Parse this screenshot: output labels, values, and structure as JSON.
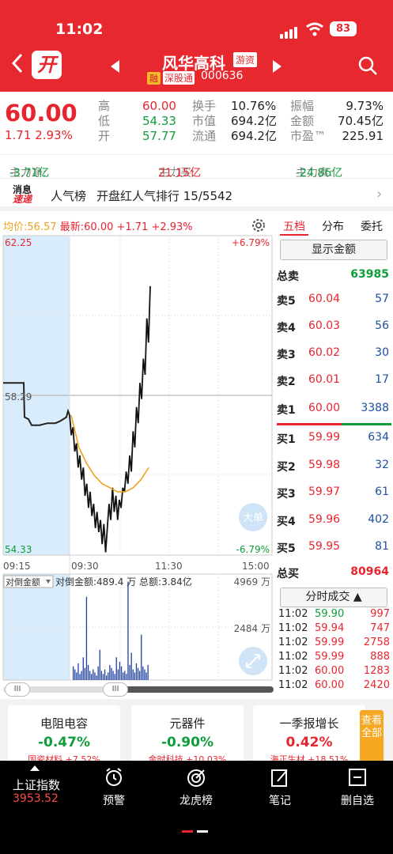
{
  "status": {
    "time": "11:02",
    "battery": "83"
  },
  "header": {
    "logo": "开",
    "stock_name": "风华高科",
    "badge_tag": "游资",
    "badge_rong": "融",
    "badge_connect": "深股通",
    "stock_code": "000636"
  },
  "quote": {
    "price": "60.00",
    "change": "1.71",
    "change_pct": "2.93%",
    "high_label": "高",
    "high": "60.00",
    "low_label": "低",
    "low": "54.33",
    "open_label": "开",
    "open": "57.77",
    "turnover_label": "换手",
    "turnover": "10.76%",
    "mktcap_label": "市值",
    "mktcap": "694.2亿",
    "float_label": "流通",
    "float": "694.2亿",
    "amplitude_label": "振幅",
    "amplitude": "9.73%",
    "amount_label": "金额",
    "amount": "70.45亿",
    "pe_label": "市盈™",
    "pe": "225.91"
  },
  "main_flow": {
    "net_label": "主力净:",
    "net": "-3.71亿",
    "buy_label": "主力买:",
    "buy": "21.15亿",
    "sell_label": "主力卖:",
    "sell": "-24.86亿"
  },
  "news": {
    "logo_top": "消息",
    "logo_bottom": "速递",
    "title": "人气榜",
    "text": "开盘红人气排行 15/5542"
  },
  "chart_info": {
    "avg_label": "均价:",
    "avg": "56.57",
    "latest_label": "最新:",
    "latest": "60.00 +1.71 +2.93%"
  },
  "chart_labels": {
    "top_price": "62.25",
    "top_pct": "+6.79%",
    "mid_price": "58.29",
    "bottom_price": "54.33",
    "bottom_pct": "-6.79%",
    "t0": "09:15",
    "t1": "09:30",
    "t2": "11:30",
    "t3": "15:00",
    "big_order": "大单",
    "vol_selector": "对倒金额",
    "vol_info": "对倒金额:489.4 万 总额:3.84亿",
    "vol_max": "4969 万",
    "vol_mid": "2484 万"
  },
  "chart_data": {
    "type": "line",
    "title": "",
    "ylim": [
      54.33,
      62.25
    ],
    "prev_close": 58.29,
    "x_labels": [
      "09:15",
      "09:30",
      "11:30",
      "15:00"
    ],
    "series": [
      {
        "values": [
          58.6,
          58.6,
          57.75,
          57.7,
          57.55,
          57.55,
          57.6,
          57.6,
          57.65,
          57.7,
          57.75,
          57.9,
          57.8
        ]
      },
      {
        "values": [
          57.8,
          57.0,
          56.6,
          56.3,
          56.1,
          56.0,
          55.9,
          55.9,
          56.0,
          56.2,
          56.5
        ]
      }
    ],
    "volume": {
      "max": 4969,
      "unit": "万"
    }
  },
  "orderbook": {
    "tabs": [
      "五档",
      "分布",
      "委托"
    ],
    "show_amount": "显示金额",
    "total_sell_label": "总卖",
    "total_sell": "63985",
    "asks": [
      {
        "label": "卖5",
        "price": "60.04",
        "vol": "57"
      },
      {
        "label": "卖4",
        "price": "60.03",
        "vol": "56"
      },
      {
        "label": "卖3",
        "price": "60.02",
        "vol": "30"
      },
      {
        "label": "卖2",
        "price": "60.01",
        "vol": "17"
      },
      {
        "label": "卖1",
        "price": "60.00",
        "vol": "3388"
      }
    ],
    "bids": [
      {
        "label": "买1",
        "price": "59.99",
        "vol": "634"
      },
      {
        "label": "买2",
        "price": "59.98",
        "vol": "32"
      },
      {
        "label": "买3",
        "price": "59.97",
        "vol": "61"
      },
      {
        "label": "买4",
        "price": "59.96",
        "vol": "402"
      },
      {
        "label": "买5",
        "price": "59.95",
        "vol": "81"
      }
    ],
    "total_buy_label": "总买",
    "total_buy": "80964",
    "ticks_label": "分时成交 ▲",
    "ticks": [
      {
        "time": "11:02",
        "price": "59.90",
        "vol": "997"
      },
      {
        "time": "11:02",
        "price": "59.94",
        "vol": "747"
      },
      {
        "time": "11:02",
        "price": "59.99",
        "vol": "2758"
      },
      {
        "time": "11:02",
        "price": "59.99",
        "vol": "888"
      },
      {
        "time": "11:02",
        "price": "60.00",
        "vol": "1283"
      },
      {
        "time": "11:02",
        "price": "60.00",
        "vol": "2420"
      }
    ]
  },
  "sectors": [
    {
      "name": "电阻电容",
      "change": "-0.47%",
      "sub": "国瓷材料 +7.52%"
    },
    {
      "name": "元器件",
      "change": "-0.90%",
      "sub": "金时科技 +10.03%"
    },
    {
      "name": "一季报增长",
      "change": "0.42%",
      "sub": "海正生材 +18.51%"
    }
  ],
  "side_tag": "查看全部",
  "bottom_nav": {
    "index_name": "上证指数",
    "index_value": "3953.52",
    "items": [
      "预警",
      "龙虎榜",
      "笔记",
      "删自选"
    ]
  },
  "colors": {
    "brand": "#e8282f",
    "up": "#e8252f",
    "down": "#0f9d3a",
    "volume": "#1e3fa0",
    "avg_line": "#f0a020"
  }
}
